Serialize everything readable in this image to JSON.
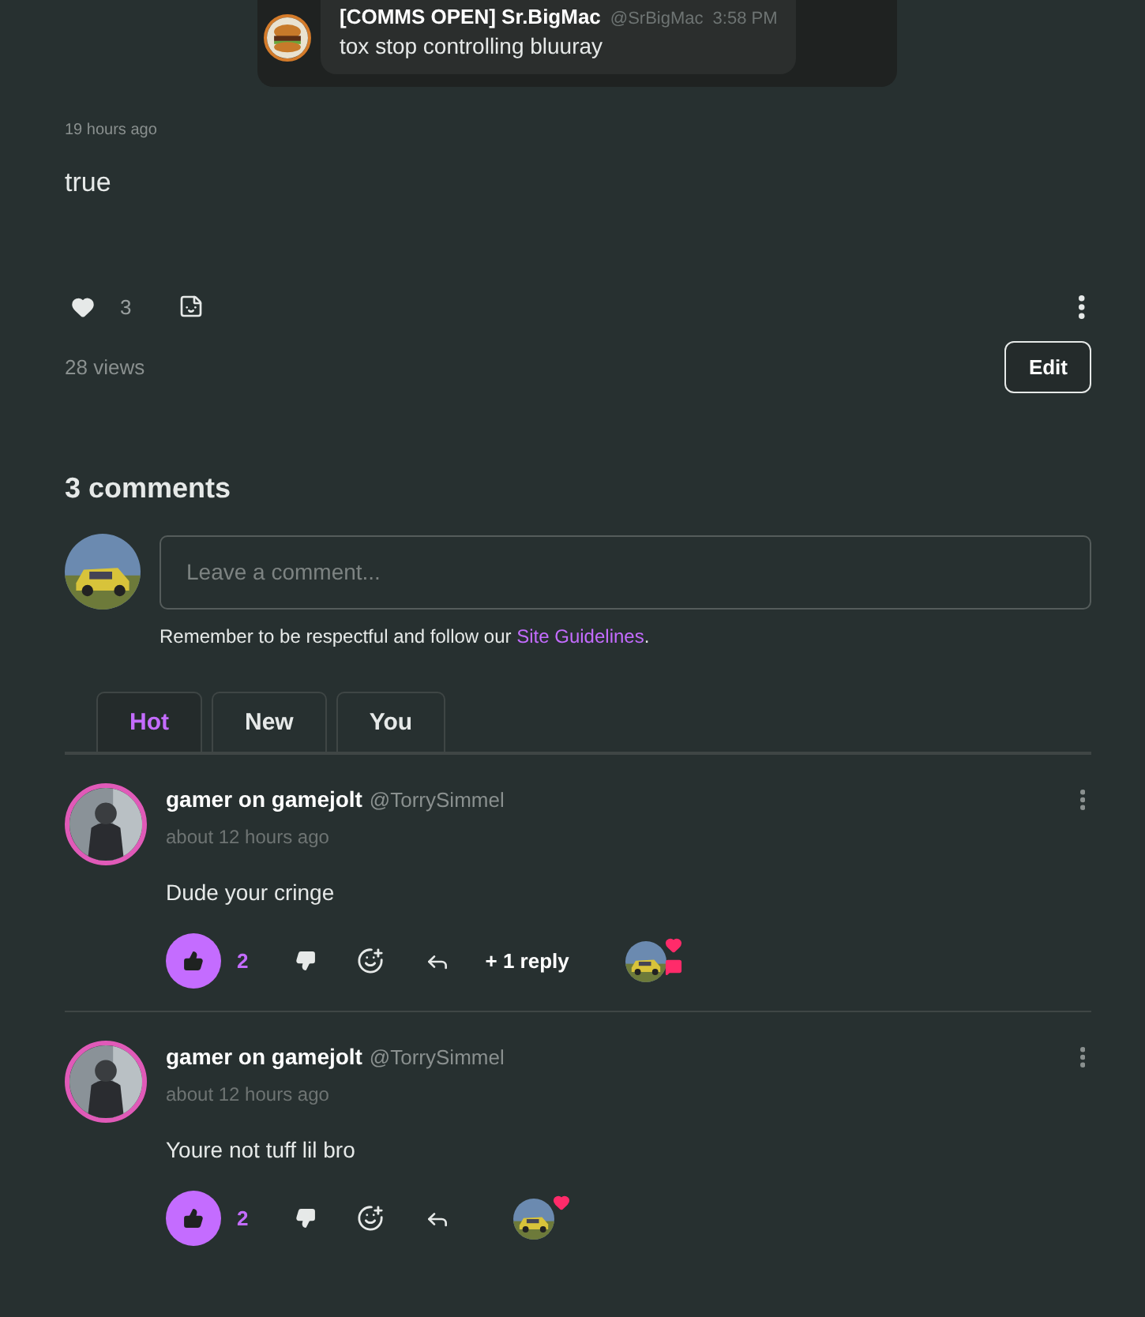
{
  "embed": {
    "author": "[COMMS OPEN] Sr.BigMac",
    "handle": "@SrBigMac",
    "time": "3:58 PM",
    "message": "tox stop controlling bluuray"
  },
  "post": {
    "time": "19 hours ago",
    "body": "true",
    "like_count": "3",
    "liked": false,
    "views": "28 views",
    "edit_label": "Edit"
  },
  "comments_section": {
    "title": "3 comments",
    "input": {
      "placeholder": "Leave a comment..."
    },
    "guidelines_prefix": "Remember to be respectful and follow our ",
    "guidelines_link": "Site Guidelines",
    "guidelines_suffix": "."
  },
  "tabs": [
    {
      "label": "Hot",
      "selected": true
    },
    {
      "label": "New",
      "selected": false
    },
    {
      "label": "You",
      "selected": false
    }
  ],
  "comments": [
    {
      "name": "gamer on gamejolt",
      "handle": "@TorrySimmel",
      "time": "about 12 hours ago",
      "text": "Dude your cringe",
      "liked": true,
      "like_count": "2",
      "replies": "+ 1 reply",
      "author_reactions": [
        {
          "kind": "heart"
        },
        {
          "kind": "comment"
        }
      ]
    },
    {
      "name": "gamer on gamejolt",
      "handle": "@TorrySimmel",
      "time": "about 12 hours ago",
      "text": "Youre not tuff lil bro",
      "liked": true,
      "like_count": "2",
      "author_reactions": [
        {
          "kind": "heart"
        }
      ]
    }
  ]
}
